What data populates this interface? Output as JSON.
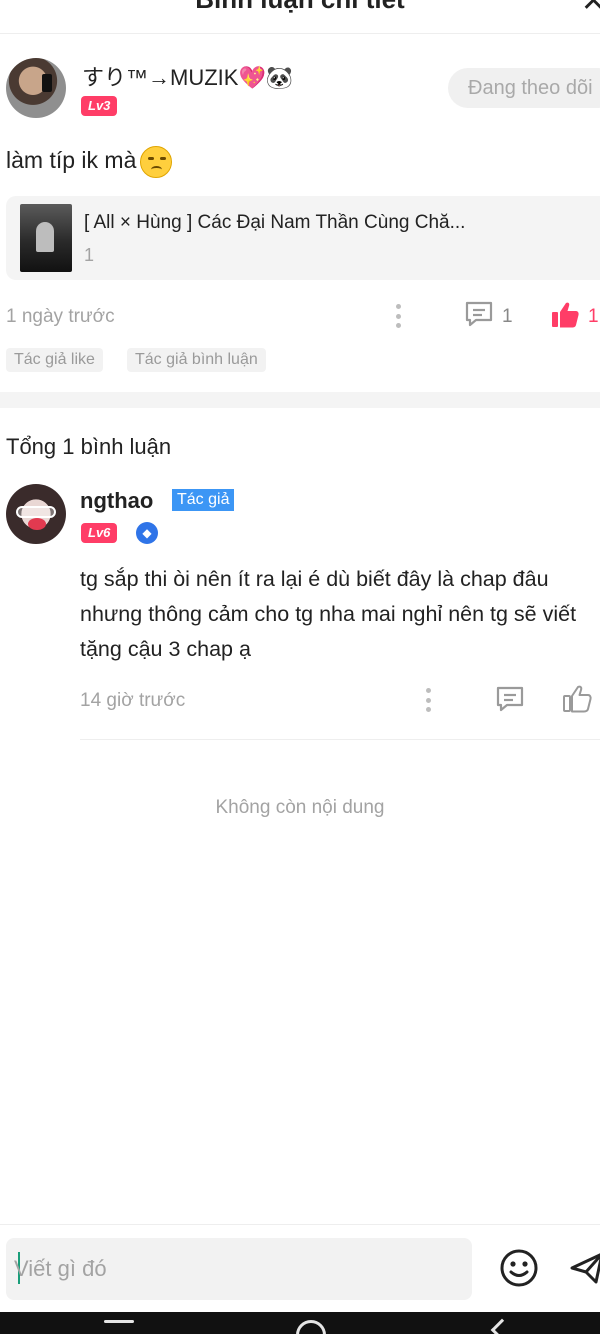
{
  "header": {
    "title": "Bình luận chi tiết",
    "close": "✕"
  },
  "main_comment": {
    "username": "すり™→MUZIK💖🐼",
    "level": "Lv3",
    "follow_label": "Đang theo dõi",
    "text": "làm típ ik mà",
    "book": {
      "title": "[ All × Hùng ] Các Đại Nam Thần Cùng Chă...",
      "count": "1"
    },
    "time": "1 ngày trước",
    "reply_count": "1",
    "like_count": "1",
    "tags": [
      "Tác giả like",
      "Tác giả bình luận"
    ]
  },
  "replies_section": {
    "total": "Tổng 1 bình luận"
  },
  "reply": {
    "username": "ngthao",
    "author_tag": "Tác giả",
    "level": "Lv6",
    "text": "tg sắp thi òi nên ít ra lại é dù biết đây là chap đâu nhưng thông cảm cho tg nha mai nghỉ nên tg sẽ viết tặng cậu 3 chap ạ",
    "time": "14 giờ trước"
  },
  "footer": {
    "no_more": "Không còn nội dung",
    "input_placeholder": "Viết gì đó"
  },
  "colors": {
    "accent_pink": "#ff3d67",
    "author_blue": "#3c96f5",
    "muted_gray": "#a3a3a3"
  },
  "icons": [
    "close-icon",
    "more-dots-icon",
    "comment-icon",
    "thumbs-up-filled-icon",
    "thumbs-up-outline-icon",
    "diamond-badge-icon",
    "emoji-icon",
    "send-icon",
    "nav-menu-icon",
    "nav-home-icon",
    "nav-back-icon"
  ]
}
